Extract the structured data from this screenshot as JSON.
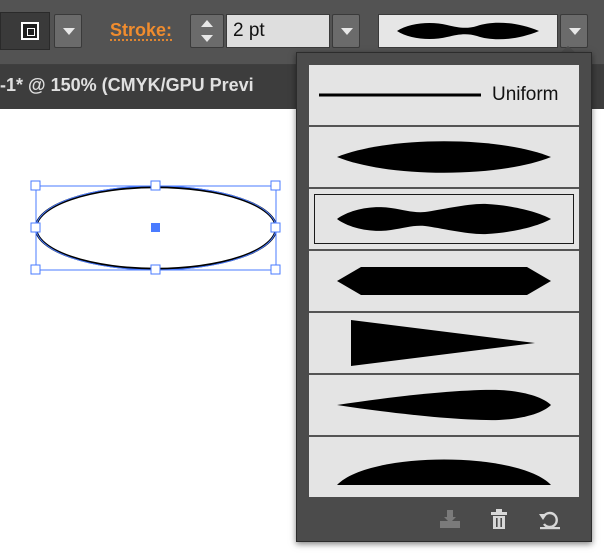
{
  "control_bar": {
    "stroke_label": "Stroke:",
    "weight_value": "2 pt",
    "stroke_swatch_icon": "stroke-swatch-icon",
    "dropdown_icon": "chevron-down-icon",
    "spinner_icon": "spinner-arrows-icon",
    "selected_profile": "width-profile-2"
  },
  "document": {
    "title": "-1* @ 150% (CMYK/GPU Previ"
  },
  "profiles_popup": {
    "items": [
      {
        "id": "uniform",
        "label": "Uniform",
        "selected": false
      },
      {
        "id": "width-profile-1",
        "label": "",
        "selected": false
      },
      {
        "id": "width-profile-2",
        "label": "",
        "selected": true
      },
      {
        "id": "width-profile-3",
        "label": "",
        "selected": false
      },
      {
        "id": "width-profile-4",
        "label": "",
        "selected": false
      },
      {
        "id": "width-profile-5",
        "label": "",
        "selected": false
      },
      {
        "id": "width-profile-6",
        "label": "",
        "selected": false
      }
    ],
    "footer_icons": [
      "add-to-profiles-icon",
      "trash-icon",
      "reset-profiles-icon"
    ]
  },
  "colors": {
    "accent_orange": "#f08c2e",
    "selection_blue": "#4a7bff",
    "panel_bg": "#535353",
    "item_bg": "#e4e4e4"
  }
}
